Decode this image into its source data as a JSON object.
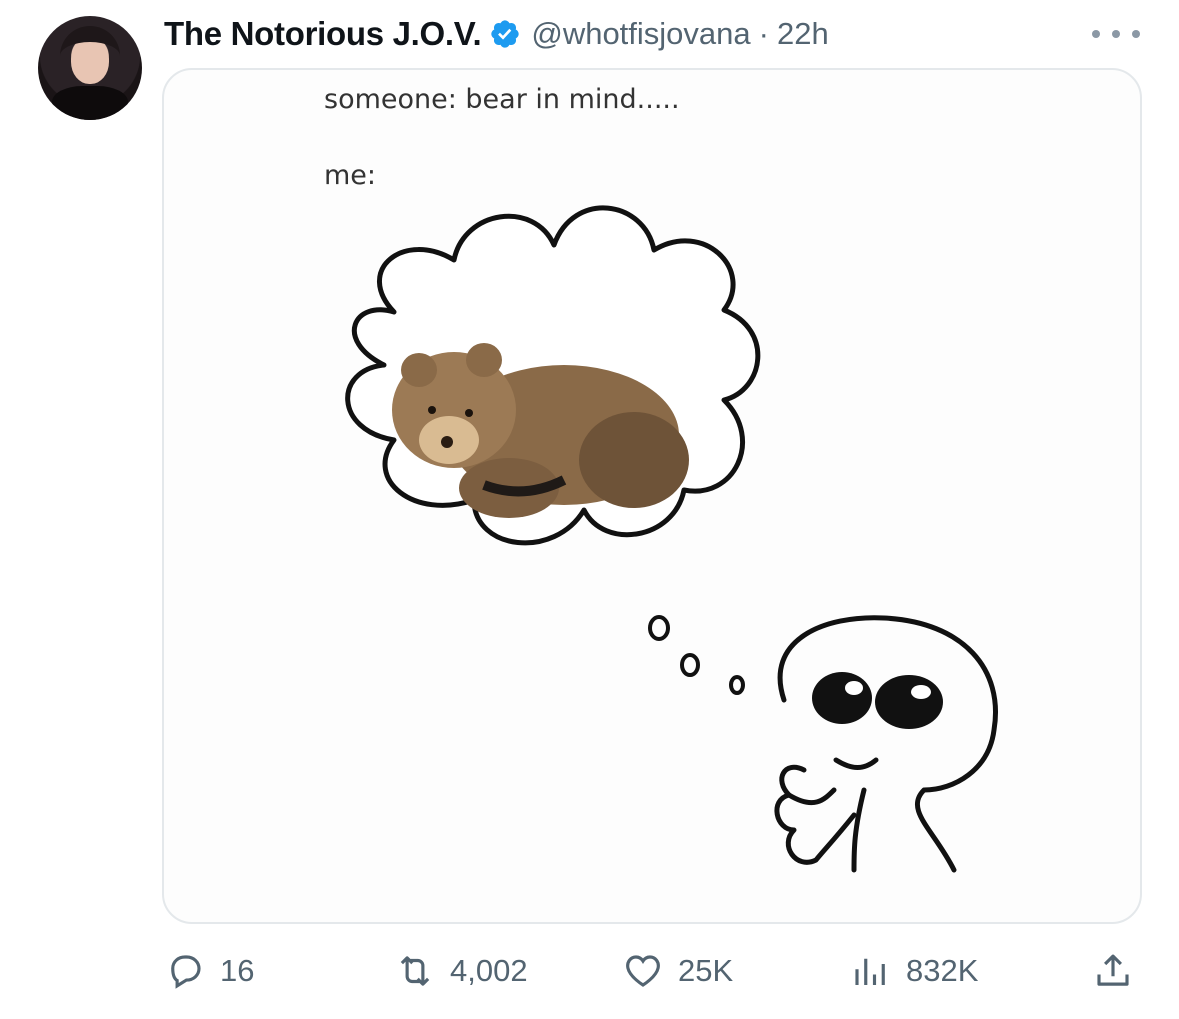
{
  "tweet": {
    "author_name": "The Notorious J.O.V.",
    "handle": "@whotfisjovana",
    "separator": "·",
    "time": "22h",
    "verified": true,
    "verified_color": "#1d9bf0",
    "media": {
      "caption_line1": "someone: bear in mind.....",
      "caption_line2": "me:"
    }
  },
  "actions": {
    "reply_icon": "reply-icon",
    "reply_count": "16",
    "retweet_icon": "retweet-icon",
    "retweet_count": "4,002",
    "like_icon": "heart-icon",
    "like_count": "25K",
    "views_icon": "views-chart-icon",
    "views_count": "832K",
    "share_icon": "share-icon"
  },
  "colors": {
    "text_primary": "#0f1419",
    "text_secondary": "#536471",
    "border": "#e4e8eb"
  }
}
